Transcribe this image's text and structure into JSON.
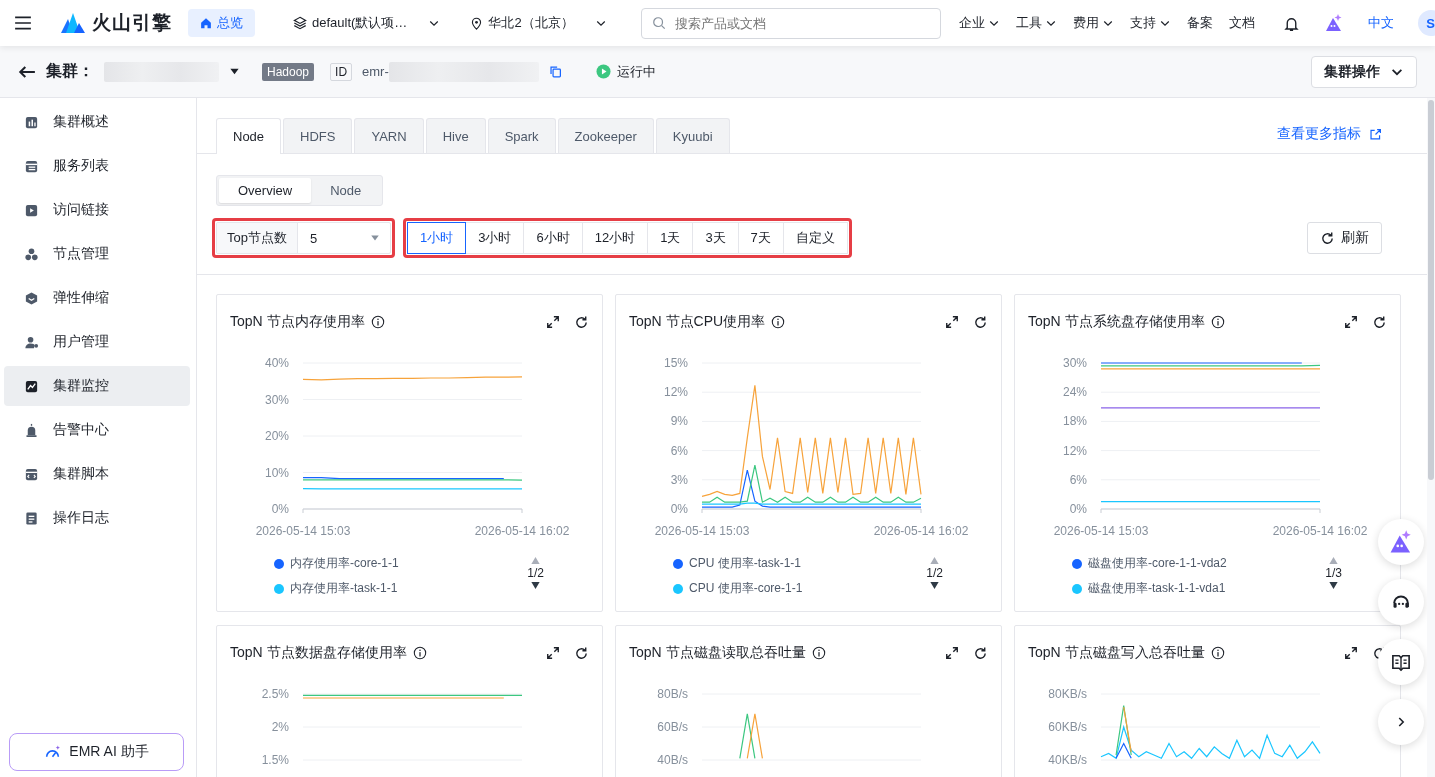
{
  "topbar": {
    "brand": "火山引擎",
    "home": {
      "label": "总览",
      "selected": true
    },
    "project": "default(默认项…",
    "region": "华北2（北京）",
    "search": {
      "placeholder": "搜索产品或文档"
    },
    "nav": [
      {
        "label": "企业",
        "dropdown": true
      },
      {
        "label": "工具",
        "dropdown": true
      },
      {
        "label": "费用",
        "dropdown": true
      },
      {
        "label": "支持",
        "dropdown": true
      },
      {
        "label": "备案",
        "dropdown": false
      },
      {
        "label": "文档",
        "dropdown": false
      }
    ],
    "language": {
      "label": "中文",
      "selected": true
    },
    "avatar": "S"
  },
  "cluster_header": {
    "label": "集群：",
    "type_tag": "Hadoop",
    "id_label": "ID",
    "id_prefix": "emr-",
    "status": "运行中",
    "actions_button": "集群操作"
  },
  "sidebar": {
    "items": [
      {
        "label": "集群概述",
        "selected": false
      },
      {
        "label": "服务列表",
        "selected": false
      },
      {
        "label": "访问链接",
        "selected": false
      },
      {
        "label": "节点管理",
        "selected": false
      },
      {
        "label": "弹性伸缩",
        "selected": false
      },
      {
        "label": "用户管理",
        "selected": false
      },
      {
        "label": "集群监控",
        "selected": true
      },
      {
        "label": "告警中心",
        "selected": false
      },
      {
        "label": "集群脚本",
        "selected": false
      },
      {
        "label": "操作日志",
        "selected": false
      }
    ],
    "assistant_button": "EMR AI 助手"
  },
  "tabs": [
    {
      "label": "Node",
      "selected": true
    },
    {
      "label": "HDFS",
      "selected": false
    },
    {
      "label": "YARN",
      "selected": false
    },
    {
      "label": "Hive",
      "selected": false
    },
    {
      "label": "Spark",
      "selected": false
    },
    {
      "label": "Zookeeper",
      "selected": false
    },
    {
      "label": "Kyuubi",
      "selected": false
    }
  ],
  "more_metrics_link": "查看更多指标",
  "view_switch": [
    {
      "label": "Overview",
      "selected": true
    },
    {
      "label": "Node",
      "selected": false
    }
  ],
  "top_nodes": {
    "label": "Top节点数",
    "value": "5",
    "highlighted": true
  },
  "time_range": {
    "highlighted": true,
    "options": [
      {
        "label": "1小时",
        "selected": true
      },
      {
        "label": "3小时",
        "selected": false
      },
      {
        "label": "6小时",
        "selected": false
      },
      {
        "label": "12小时",
        "selected": false
      },
      {
        "label": "1天",
        "selected": false
      },
      {
        "label": "3天",
        "selected": false
      },
      {
        "label": "7天",
        "selected": false
      },
      {
        "label": "自定义",
        "selected": false
      }
    ]
  },
  "refresh_button": "刷新",
  "charts": [
    {
      "title": "TopN 节点内存使用率",
      "legend_page": "1/2",
      "chart_data": {
        "type": "line",
        "grid": true,
        "categories": [
          "2026-05-14 15:03",
          null,
          null,
          null,
          null,
          null,
          null,
          null,
          null,
          null,
          null,
          null,
          "2026-05-14 16:02"
        ],
        "ylim": [
          0,
          40
        ],
        "yticks": [
          {
            "value": 0,
            "label": "0%"
          },
          {
            "value": 10,
            "label": "10%"
          },
          {
            "value": 20,
            "label": "20%"
          },
          {
            "value": 30,
            "label": "30%"
          },
          {
            "value": 40,
            "label": "40%"
          }
        ],
        "series": [
          {
            "name": "内存使用率-core-1-1",
            "color": "#1664ff",
            "values": [
              8.6,
              8.6,
              8.3,
              8.3,
              8.3,
              8.3,
              8.3,
              8.3,
              8.3,
              8.3,
              8.3,
              8.3,
              null
            ]
          },
          {
            "name": "内存使用率-task-1-1",
            "color": "#1ac6ff",
            "values": [
              5.6,
              5.5,
              5.5,
              5.5,
              5.5,
              5.5,
              5.5,
              5.5,
              5.5,
              5.5,
              5.5,
              5.5,
              5.5
            ]
          },
          {
            "color": "#f7a33b",
            "values": [
              35.5,
              35.4,
              35.6,
              35.7,
              35.7,
              35.8,
              35.8,
              35.9,
              35.9,
              36.0,
              36.1,
              36.1,
              36.2
            ]
          },
          {
            "color": "#3cc780",
            "values": [
              8.0,
              8.0,
              8.0,
              8.0,
              8.0,
              8.0,
              8.0,
              8.0,
              8.0,
              8.0,
              8.0,
              8.0,
              7.9
            ]
          }
        ]
      }
    },
    {
      "title": "TopN 节点CPU使用率",
      "legend_page": "1/2",
      "chart_data": {
        "type": "line",
        "grid": true,
        "categories": [
          "2026-05-14 15:03",
          null,
          null,
          null,
          null,
          null,
          null,
          null,
          null,
          null,
          null,
          null,
          null,
          null,
          null,
          null,
          null,
          null,
          null,
          null,
          null,
          null,
          null,
          null,
          null,
          null,
          null,
          null,
          null,
          "2026-05-14 16:02"
        ],
        "ylim": [
          0,
          15
        ],
        "yticks": [
          {
            "value": 0,
            "label": "0%"
          },
          {
            "value": 3,
            "label": "3%"
          },
          {
            "value": 6,
            "label": "6%"
          },
          {
            "value": 9,
            "label": "9%"
          },
          {
            "value": 12,
            "label": "12%"
          },
          {
            "value": 15,
            "label": "15%"
          }
        ],
        "series": [
          {
            "name": "CPU 使用率-task-1-1",
            "color": "#1664ff",
            "values": [
              0.2,
              0.2,
              0.2,
              0.2,
              0.2,
              0.4,
              4.0,
              0.8,
              0.3,
              0.2,
              0.2,
              0.2,
              0.2,
              0.2,
              0.2,
              0.2,
              0.2,
              0.2,
              0.2,
              0.2,
              0.2,
              0.2,
              0.2,
              0.2,
              0.2,
              0.2,
              0.2,
              0.2,
              0.2,
              0.2
            ]
          },
          {
            "name": "CPU 使用率-core-1-1",
            "color": "#1ac6ff",
            "values": [
              0.5,
              0.5,
              0.5,
              0.5,
              0.5,
              0.5,
              0.6,
              0.6,
              0.5,
              0.5,
              0.5,
              0.5,
              0.5,
              0.5,
              0.5,
              0.5,
              0.5,
              0.5,
              0.5,
              0.5,
              0.5,
              0.5,
              0.5,
              0.5,
              0.5,
              0.5,
              0.5,
              0.5,
              0.5,
              0.5
            ]
          },
          {
            "color": "#f7a33b",
            "values": [
              1.3,
              1.5,
              1.8,
              1.5,
              1.4,
              1.6,
              7.3,
              12.7,
              5.4,
              2.0,
              7.3,
              1.8,
              1.6,
              7.3,
              1.7,
              7.3,
              1.6,
              7.3,
              1.7,
              7.3,
              1.5,
              1.6,
              7.3,
              1.6,
              7.3,
              1.6,
              7.3,
              1.5,
              7.3,
              1.5
            ]
          },
          {
            "color": "#3cc780",
            "values": [
              0.7,
              0.7,
              1.2,
              0.7,
              0.7,
              0.7,
              0.8,
              4.5,
              0.7,
              1.1,
              0.7,
              1.2,
              0.7,
              0.7,
              1.2,
              0.7,
              0.7,
              1.2,
              0.7,
              0.7,
              1.2,
              0.7,
              0.7,
              1.2,
              0.7,
              0.7,
              1.2,
              0.7,
              0.7,
              1.1
            ]
          }
        ]
      }
    },
    {
      "title": "TopN 节点系统盘存储使用率",
      "legend_page": "1/3",
      "chart_data": {
        "type": "line",
        "grid": true,
        "categories": [
          "2026-05-14 15:03",
          null,
          null,
          null,
          null,
          null,
          null,
          null,
          null,
          null,
          null,
          null,
          "2026-05-14 16:02"
        ],
        "ylim": [
          0,
          30
        ],
        "yticks": [
          {
            "value": 0,
            "label": "0%"
          },
          {
            "value": 6,
            "label": "6%"
          },
          {
            "value": 12,
            "label": "12%"
          },
          {
            "value": 18,
            "label": "18%"
          },
          {
            "value": 24,
            "label": "24%"
          },
          {
            "value": 30,
            "label": "30%"
          }
        ],
        "series": [
          {
            "name": "磁盘使用率-core-1-1-vda2",
            "color": "#1664ff",
            "values": [
              30.0,
              30.0,
              30.0,
              30.0,
              30.0,
              30.0,
              30.0,
              30.0,
              30.0,
              30.0,
              30.0,
              30.0,
              null
            ]
          },
          {
            "name": "磁盘使用率-task-1-1-vda1",
            "color": "#1ac6ff",
            "values": [
              1.5,
              1.5,
              1.5,
              1.5,
              1.5,
              1.5,
              1.5,
              1.5,
              1.5,
              1.5,
              1.5,
              1.5,
              1.5
            ]
          },
          {
            "color": "#f7a33b",
            "values": [
              28.8,
              28.8,
              28.8,
              28.8,
              28.8,
              28.8,
              28.8,
              28.8,
              28.8,
              28.8,
              28.8,
              28.8,
              28.8
            ]
          },
          {
            "color": "#8a63e8",
            "values": [
              20.8,
              20.8,
              20.8,
              20.8,
              20.8,
              20.8,
              20.8,
              20.8,
              20.8,
              20.8,
              20.8,
              20.8,
              20.8
            ]
          },
          {
            "color": "#3cc780",
            "values": [
              29.4,
              29.4,
              29.4,
              29.4,
              29.4,
              29.4,
              29.4,
              29.4,
              29.4,
              29.4,
              29.4,
              29.4,
              29.5
            ]
          }
        ]
      }
    },
    {
      "title": "TopN 节点数据盘存储使用率",
      "chart_data": {
        "type": "line",
        "grid": true,
        "categories": [
          null,
          null,
          null,
          null,
          null,
          null,
          null,
          null,
          null,
          null,
          null,
          null,
          null
        ],
        "ylim": [
          1.5,
          2.5
        ],
        "yticks": [
          {
            "value": 1.5,
            "label": "1.5%"
          },
          {
            "value": 2,
            "label": "2%"
          },
          {
            "value": 2.5,
            "label": "2.5%"
          }
        ],
        "series": [
          {
            "color": "#f7a33b",
            "values": [
              2.44,
              2.44,
              2.44,
              2.44,
              2.44,
              2.44,
              2.44,
              2.44,
              2.44,
              2.44,
              2.44,
              2.44,
              null
            ]
          },
          {
            "color": "#3cc780",
            "values": [
              2.48,
              2.48,
              2.48,
              2.48,
              2.48,
              2.48,
              2.48,
              2.48,
              2.48,
              2.48,
              2.48,
              2.48,
              2.48
            ]
          }
        ]
      }
    },
    {
      "title": "TopN 节点磁盘读取总吞吐量",
      "chart_data": {
        "type": "line",
        "grid": true,
        "categories": [
          null,
          null,
          null,
          null,
          null,
          null,
          null,
          null,
          null,
          null,
          null,
          null,
          null,
          null,
          null,
          null,
          null,
          null,
          null,
          null,
          null,
          null,
          null,
          null,
          null,
          null,
          null,
          null,
          null,
          null
        ],
        "ylim": [
          40,
          80
        ],
        "yticks": [
          {
            "value": 40,
            "label": "40B/s"
          },
          {
            "value": 60,
            "label": "60B/s"
          },
          {
            "value": 80,
            "label": "80B/s"
          }
        ],
        "series": [
          {
            "color": "#3cc780",
            "values": [
              null,
              null,
              null,
              null,
              null,
              41,
              68,
              41,
              null,
              null,
              null,
              null,
              null,
              null,
              null,
              null,
              null,
              null,
              null,
              null,
              null,
              null,
              null,
              null,
              null,
              null,
              null,
              null,
              null,
              null
            ]
          },
          {
            "color": "#f7a33b",
            "values": [
              null,
              null,
              null,
              null,
              null,
              null,
              41,
              68,
              41,
              null,
              null,
              null,
              null,
              null,
              null,
              null,
              null,
              null,
              null,
              null,
              null,
              null,
              null,
              null,
              null,
              null,
              null,
              null,
              null,
              null
            ]
          }
        ]
      }
    },
    {
      "title": "TopN 节点磁盘写入总吞吐量",
      "chart_data": {
        "type": "line",
        "grid": true,
        "categories": [
          null,
          null,
          null,
          null,
          null,
          null,
          null,
          null,
          null,
          null,
          null,
          null,
          null,
          null,
          null,
          null,
          null,
          null,
          null,
          null,
          null,
          null,
          null,
          null,
          null,
          null,
          null,
          null,
          null,
          null
        ],
        "ylim": [
          40,
          80
        ],
        "yticks": [
          {
            "value": 40,
            "label": "40KB/s"
          },
          {
            "value": 60,
            "label": "60KB/s"
          },
          {
            "value": 80,
            "label": "80KB/s"
          }
        ],
        "series": [
          {
            "color": "#1ac6ff",
            "values": [
              42,
              44,
              41,
              60,
              46,
              42,
              45,
              43,
              41,
              50,
              42,
              45,
              41,
              47,
              42,
              48,
              44,
              41,
              52,
              42,
              46,
              41,
              55,
              44,
              42,
              49,
              41,
              45,
              51,
              44
            ]
          },
          {
            "color": "#1664ff",
            "values": [
              null,
              null,
              41,
              50,
              41,
              null,
              null,
              null,
              null,
              null,
              null,
              null,
              null,
              null,
              null,
              null,
              null,
              null,
              null,
              null,
              null,
              null,
              null,
              null,
              null,
              null,
              null,
              null,
              null,
              null
            ]
          },
          {
            "color": "#3cc780",
            "values": [
              null,
              null,
              43,
              73,
              43,
              null,
              null,
              null,
              null,
              null,
              null,
              null,
              null,
              null,
              null,
              null,
              null,
              null,
              null,
              null,
              null,
              null,
              null,
              null,
              null,
              null,
              null,
              null,
              null,
              null
            ]
          },
          {
            "color": "#f7a33b",
            "values": [
              null,
              null,
              null,
              72,
              45,
              null,
              null,
              null,
              null,
              null,
              null,
              null,
              null,
              null,
              null,
              null,
              null,
              null,
              null,
              null,
              null,
              null,
              null,
              null,
              null,
              null,
              null,
              null,
              null,
              null
            ]
          }
        ]
      }
    }
  ]
}
